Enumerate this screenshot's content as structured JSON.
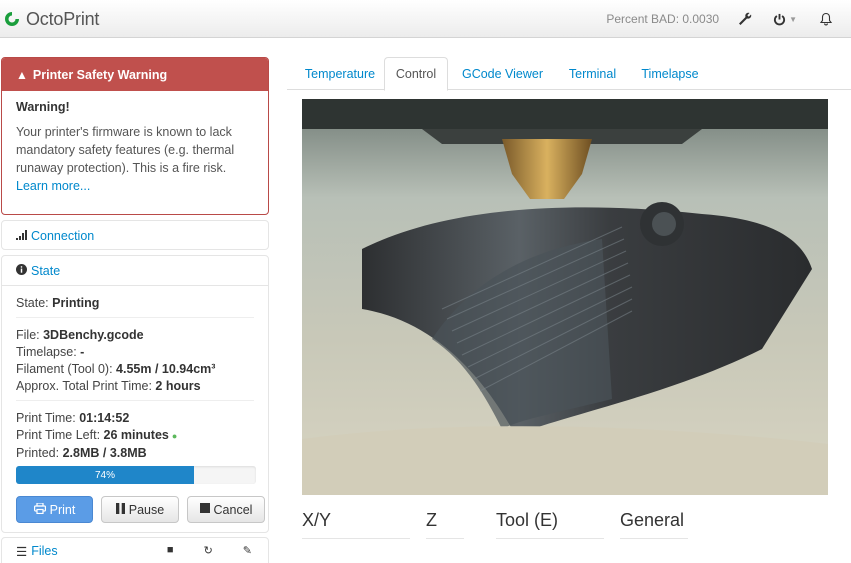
{
  "navbar": {
    "title": "OctoPrint",
    "percent_bad": "Percent BAD: 0.0030",
    "icons": [
      "octoprint-logo-icon",
      "wrench-icon",
      "power-icon",
      "bell-icon"
    ]
  },
  "warning": {
    "header": "Printer Safety Warning",
    "title": "Warning!",
    "text": "Your printer's firmware is known to lack mandatory safety features (e.g. thermal runaway protection). This is a fire risk.",
    "link": "Learn more..."
  },
  "connection": {
    "label": "Connection"
  },
  "state": {
    "label": "State",
    "state_label": "State:",
    "state_value": "Printing",
    "file_label": "File:",
    "file_value": "3DBenchy.gcode",
    "timelapse_label": "Timelapse:",
    "timelapse_value": "-",
    "filament_label": "Filament (Tool 0):",
    "filament_value": "4.55m / 10.94cm³",
    "total_label": "Approx. Total Print Time:",
    "total_value": "2 hours",
    "print_time_label": "Print Time:",
    "print_time_value": "01:14:52",
    "time_left_label": "Print Time Left:",
    "time_left_value": "26 minutes",
    "printed_label": "Printed:",
    "printed_value": "2.8MB / 3.8MB",
    "progress_text": "74%",
    "progress_fraction": 0.74
  },
  "buttons": {
    "print": "Print",
    "pause": "Pause",
    "cancel": "Cancel"
  },
  "files": {
    "label": "Files"
  },
  "tabs": [
    {
      "label": "Temperature",
      "active": false
    },
    {
      "label": "Control",
      "active": true
    },
    {
      "label": "GCode Viewer",
      "active": false
    },
    {
      "label": "Terminal",
      "active": false
    },
    {
      "label": "Timelapse",
      "active": false
    }
  ],
  "control": {
    "xy": "X/Y",
    "z": "Z",
    "tool": "Tool (E)",
    "general": "General"
  },
  "colors": {
    "danger": "#c0504d",
    "link": "#0088cc",
    "progress": "#1f86c9",
    "primary": "#5b9ce6"
  }
}
